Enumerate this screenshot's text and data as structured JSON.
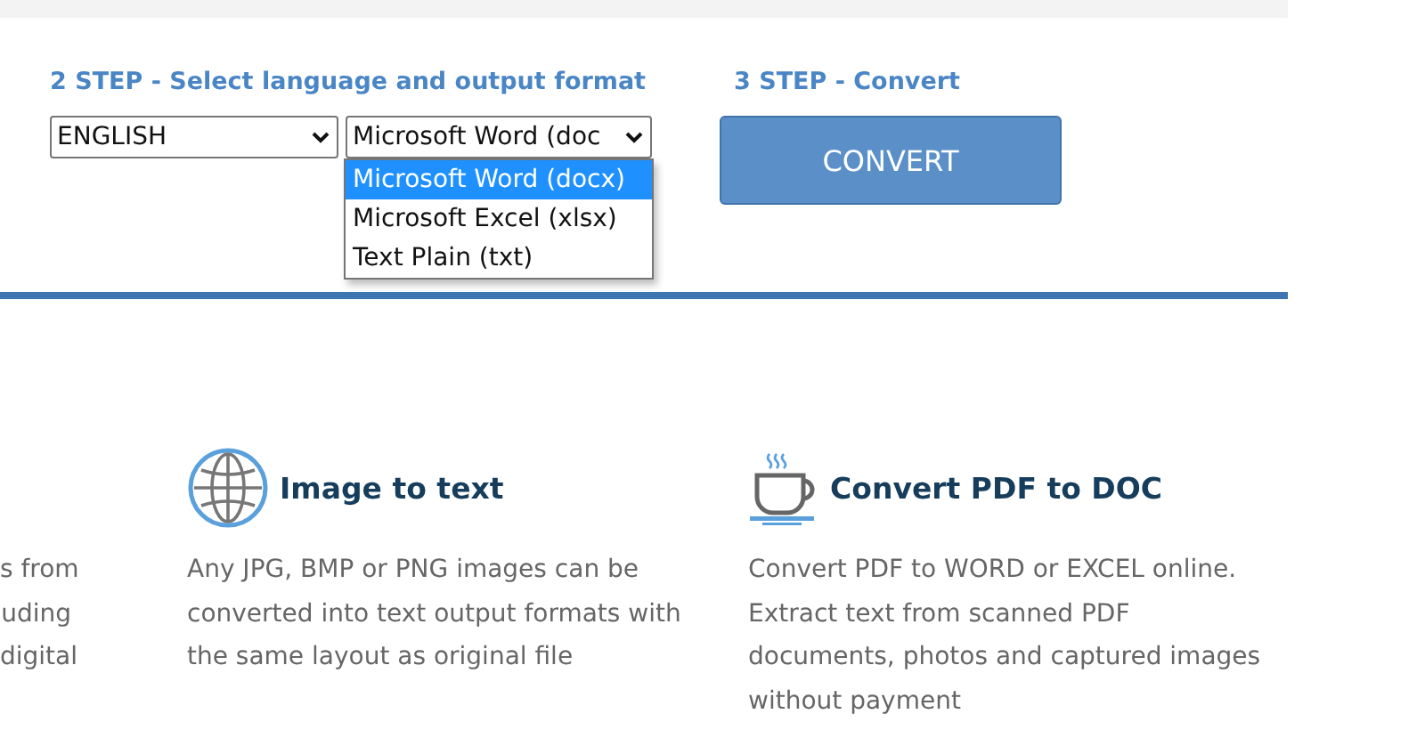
{
  "language_step": {
    "label": "2 STEP - Select language and output format",
    "language_select": {
      "value": "ENGLISH"
    },
    "format_select": {
      "value": "Microsoft Word (doc",
      "expanded": true,
      "options": [
        {
          "label": "Microsoft Word (docx)",
          "selected": true
        },
        {
          "label": "Microsoft Excel (xlsx)",
          "selected": false
        },
        {
          "label": "Text Plain (txt)",
          "selected": false
        }
      ]
    }
  },
  "convert_step": {
    "label": "3 STEP - Convert",
    "button": "CONVERT"
  },
  "features": [
    {
      "kind": "partial",
      "lines": [
        "s from",
        "uding",
        "digital"
      ]
    },
    {
      "kind": "globe",
      "title": "Image to text",
      "lines": [
        "Any JPG, BMP or PNG images can be",
        "converted into text output formats with",
        "the same layout as original file"
      ]
    },
    {
      "kind": "cup",
      "title": "Convert PDF to DOC",
      "lines": [
        "Convert PDF to WORD or EXCEL online.",
        "Extract text from scanned PDF",
        "documents, photos and captured images",
        "without payment"
      ]
    }
  ]
}
